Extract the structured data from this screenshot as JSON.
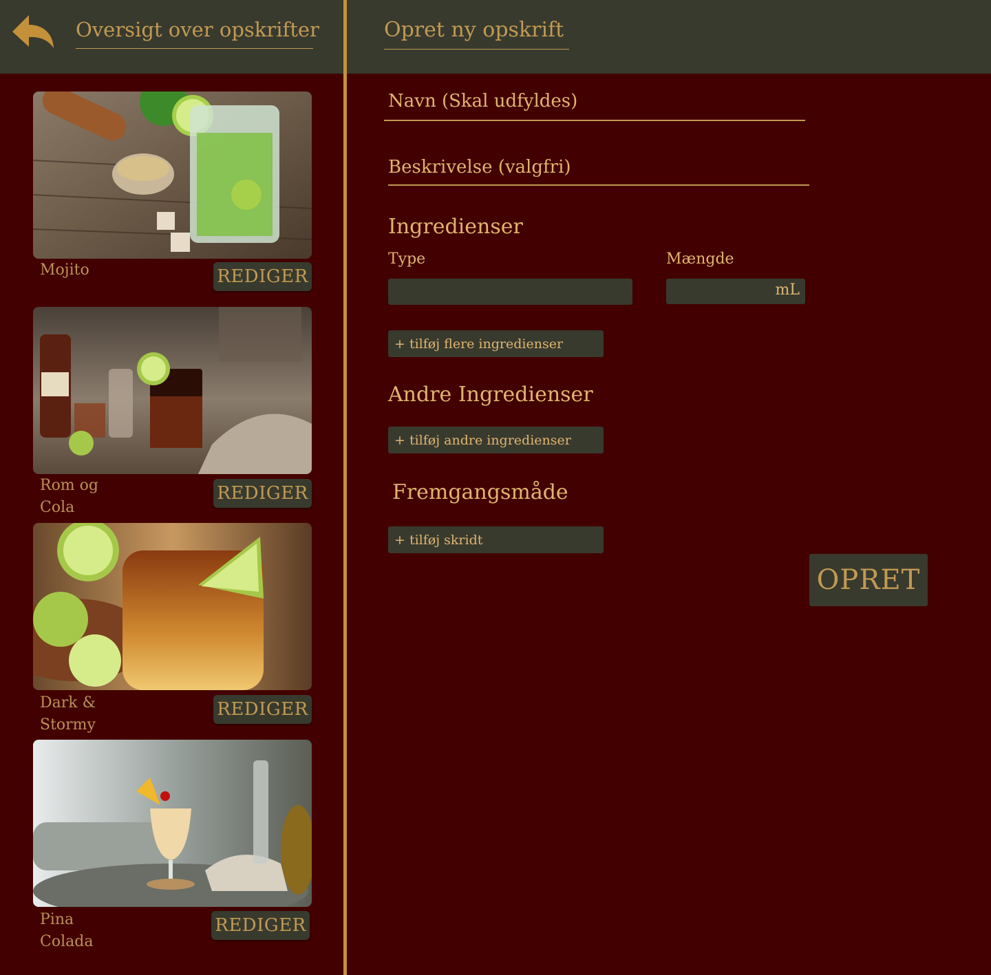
{
  "nav": {
    "back_icon": "back-arrow-icon",
    "overview_title": "Oversigt over opskrifter",
    "create_title": "Opret ny opskrift"
  },
  "recipes": [
    {
      "name": "Mojito",
      "edit_label": "REDIGER",
      "image": "mojito-photo"
    },
    {
      "name": "Rom og Cola",
      "edit_label": "REDIGER",
      "image": "rum-cola-photo"
    },
    {
      "name": "Dark & Stormy",
      "edit_label": "REDIGER",
      "image": "dark-stormy-photo"
    },
    {
      "name": "Pina Colada",
      "edit_label": "REDIGER",
      "image": "pina-colada-photo"
    }
  ],
  "form": {
    "name_placeholder": "Navn (Skal udfyldes)",
    "description_placeholder": "Beskrivelse (valgfri)",
    "ingredients_title": "Ingredienser",
    "type_label": "Type",
    "amount_label": "Mængde",
    "amount_unit": "mL",
    "add_more_ingredients": "+ tilføj flere ingredienser",
    "other_ingredients_title": "Andre Ingredienser",
    "add_other_ingredients": "+ tilføj andre ingredienser",
    "procedure_title": "Fremgangsmåde",
    "add_step": "+ tilføj skridt",
    "submit_label": "OPRET"
  },
  "colors": {
    "background": "#430000",
    "panel": "#383a2e",
    "accent": "#c4913a",
    "text": "#e0b570"
  }
}
